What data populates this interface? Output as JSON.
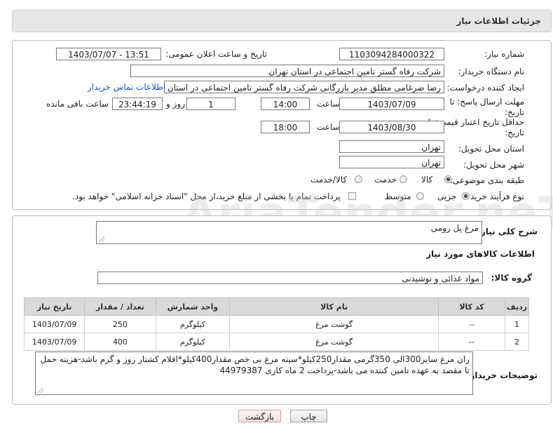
{
  "header": {
    "title": "جزئیات اطلاعات نیاز"
  },
  "watermark": "AriaTender.neT",
  "fields": {
    "need_number_label": "شماره نیاز:",
    "need_number": "1103094284000322",
    "announce_label": "تاریخ و ساعت اعلان عمومی:",
    "announce_value": "1403/07/07 - 13:51",
    "buyer_org_label": "نام دستگاه خریدار:",
    "buyer_org": "شرکت رفاه گستر تامین اجتماعی در استان تهران",
    "creator_label": "ایجاد کننده درخواست:",
    "creator": "رضا ضرغامی مطلق مدیر بازرگانی شرکت رفاه گستر تامین اجتماعی در استان تهران",
    "contact_link": "اطلاعات تماس خریدار",
    "deadline_label": "مهلت ارسال پاسخ: تا تاریخ:",
    "deadline_date": "1403/07/09",
    "time_label": "ساعت",
    "deadline_time": "14:00",
    "days_value": "1",
    "days_label": "روز و",
    "remaining_time": "23:44:19",
    "remaining_label": "ساعت باقی مانده",
    "validity_label": "حداقل تاریخ اعتبار قیمت: تا تاریخ:",
    "validity_date": "1403/08/30",
    "validity_time": "18:00",
    "province_label": "استان محل تحویل:",
    "province": "تهران",
    "city_label": "شهر محل تحویل:",
    "city": "تهران",
    "category_label": "طبقه بندی موضوعی:",
    "category_options": [
      "کالا",
      "خدمت",
      "کالا/خدمت"
    ],
    "process_label": "نوع فرآیند خرید :",
    "process_options": [
      "جزیی",
      "متوسط"
    ],
    "payment_note": "پرداخت تمام یا بخشی از مبلغ خرید،از محل \"اسناد خزانه اسلامی\" خواهد بود."
  },
  "details": {
    "summary_label": "شرح کلی نیاز:",
    "summary": "مرغ پل رومی",
    "goods_info_title": "اطلاعات کالاهای مورد نیاز",
    "goods_group_label": "گروه کالا:",
    "goods_group": "مواد غذائی و نوشیدنی",
    "table": {
      "headers": [
        "ردیف",
        "کد کالا",
        "نام کالا",
        "واحد شمارش",
        "تعداد / مقدار",
        "تاریخ نیاز"
      ],
      "rows": [
        [
          "1",
          "--",
          "گوشت مرغ",
          "کیلوگرم",
          "250",
          "1403/07/09"
        ],
        [
          "2",
          "--",
          "گوشت مرغ",
          "کیلوگرم",
          "400",
          "1403/07/09"
        ]
      ]
    },
    "buyer_notes_label": "توضیحات خریدار:",
    "buyer_notes": "ران مرغ سایز300الی 350گرمی مقدار250کیلو*سینه مرغ بی خص مقدار400کیلو*اقلام کشتار روز و گرم باشد-هزینه حمل تا مقصد به عهده تامین کننده می باشد-پرداخت 2 ماه کاری 44979387"
  },
  "buttons": {
    "print": "چاپ",
    "back": "بازگشت"
  }
}
